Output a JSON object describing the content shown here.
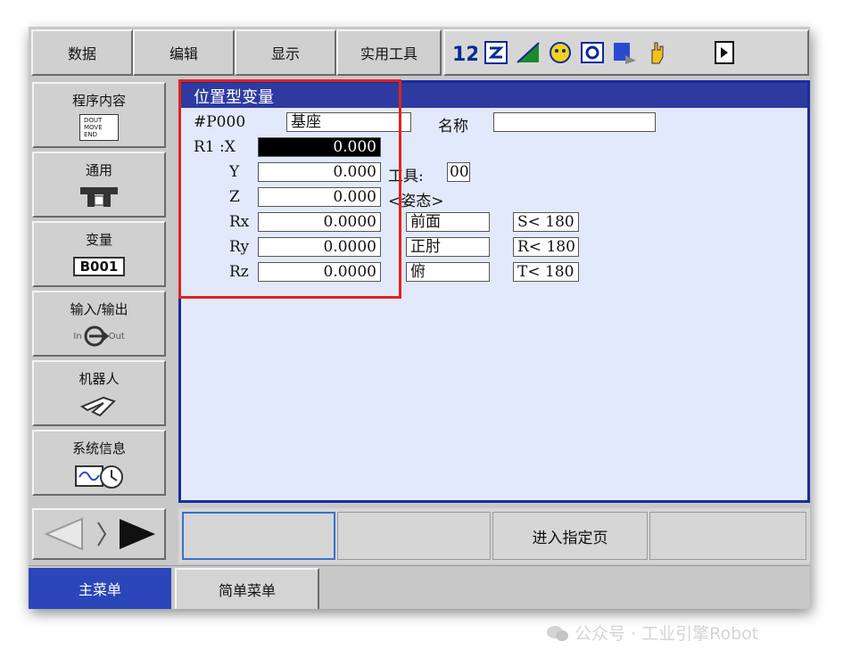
{
  "top_menu": [
    "数据",
    "编辑",
    "显示",
    "实用工具"
  ],
  "sidebar": {
    "items": [
      {
        "label": "程序内容",
        "icon_lines": [
          "DOUT",
          "MOVE",
          "END"
        ]
      },
      {
        "label": "通用"
      },
      {
        "label": "变量",
        "badge": "B001"
      },
      {
        "label": "输入/输出",
        "in": "In",
        "out": "Out"
      },
      {
        "label": "机器人"
      },
      {
        "label": "系统信息"
      }
    ]
  },
  "panel": {
    "title": "位置型变量",
    "var_id": "#P000",
    "coord": "基座",
    "name_label": "名称",
    "name_value": "",
    "robot": "R1 :X",
    "axes": [
      {
        "label": "",
        "value": "0.000"
      },
      {
        "label": "Y",
        "value": "0.000"
      },
      {
        "label": "Z",
        "value": "0.000"
      },
      {
        "label": "Rx",
        "value": "0.0000"
      },
      {
        "label": "Ry",
        "value": "0.0000"
      },
      {
        "label": "Rz",
        "value": "0.0000"
      }
    ],
    "tool_label": "工具:",
    "tool_value": "00",
    "posture_label": "<姿态>",
    "posture": [
      "前面",
      "正肘",
      "俯"
    ],
    "limits": [
      "S< 180",
      "R< 180",
      "T< 180"
    ]
  },
  "function_bar": [
    "",
    "",
    "进入指定页",
    ""
  ],
  "bottom_tabs": {
    "main": "主菜单",
    "simple": "简单菜单"
  },
  "watermark": "公众号 · 工业引擎Robot",
  "colors": {
    "accent_blue": "#2f3aa0",
    "panel_bg": "#e2e9fb",
    "highlight_red": "#e0241b",
    "main_tab": "#2a46b8"
  }
}
